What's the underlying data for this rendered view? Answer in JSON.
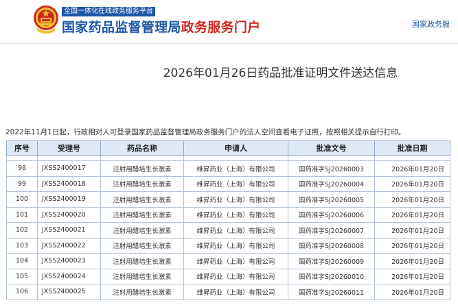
{
  "header": {
    "portal_tag": "全国一体化在线政务服务平台",
    "title_primary": "国家药品监督管理局",
    "title_accent": "政务服务门户",
    "right_link": "国家政务服"
  },
  "page": {
    "title": "2026年01月26日药品批准证明文件送达信息",
    "notice": "2022年11月1日起，行政相对人可登录国家药品监督管理局政务服务门户的法人空间查看电子证照，按照相关提示自行打印。"
  },
  "table": {
    "headers": [
      "序号",
      "受理号",
      "药品名称",
      "申请人",
      "批准文号",
      "批准日期"
    ],
    "rows": [
      {
        "no": "98",
        "accept": "JXSS2400017",
        "drug": "注射用醋培生长激素",
        "applicant": "维昇药业（上海）有限公司",
        "approval": "国药准字SJ20260003",
        "date": "2026年01月20日"
      },
      {
        "no": "99",
        "accept": "JXSS2400018",
        "drug": "注射用醋培生长激素",
        "applicant": "维昇药业（上海）有限公司",
        "approval": "国药准字SJ20260004",
        "date": "2026年01月20日"
      },
      {
        "no": "100",
        "accept": "JXSS2400019",
        "drug": "注射用醋培生长激素",
        "applicant": "维昇药业（上海）有限公司",
        "approval": "国药准字SJ20260005",
        "date": "2026年01月20日"
      },
      {
        "no": "101",
        "accept": "JXSS2400020",
        "drug": "注射用醋培生长激素",
        "applicant": "维昇药业（上海）有限公司",
        "approval": "国药准字SJ20260006",
        "date": "2026年01月20日"
      },
      {
        "no": "102",
        "accept": "JXSS2400021",
        "drug": "注射用醋培生长激素",
        "applicant": "维昇药业（上海）有限公司",
        "approval": "国药准字SJ20260007",
        "date": "2026年01月20日"
      },
      {
        "no": "103",
        "accept": "JXSS2400022",
        "drug": "注射用醋培生长激素",
        "applicant": "维昇药业（上海）有限公司",
        "approval": "国药准字SJ20260008",
        "date": "2026年01月20日"
      },
      {
        "no": "104",
        "accept": "JXSS2400023",
        "drug": "注射用醋培生长激素",
        "applicant": "维昇药业（上海）有限公司",
        "approval": "国药准字SJ20260009",
        "date": "2026年01月20日"
      },
      {
        "no": "105",
        "accept": "JXSS2400024",
        "drug": "注射用醋培生长激素",
        "applicant": "维昇药业（上海）有限公司",
        "approval": "国药准字SJ20260010",
        "date": "2026年01月20日"
      },
      {
        "no": "106",
        "accept": "JXSS2400025",
        "drug": "注射用醋培生长激素",
        "applicant": "维昇药业（上海）有限公司",
        "approval": "国药准字SJ20260011",
        "date": "2026年01月20日"
      }
    ]
  },
  "icons": {
    "emblem": "national-emblem-icon"
  },
  "colors": {
    "brand_blue": "#1d57a7",
    "accent_red": "#d0281f",
    "header_cell_bg": "#dfe9f6"
  }
}
